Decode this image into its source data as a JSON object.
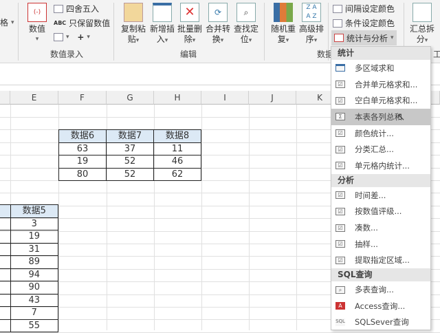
{
  "ribbon": {
    "cut_left_label": "格",
    "number_value": {
      "label": "数值"
    },
    "round": "四舍五入",
    "keep_value": "只保留数值",
    "plus": "+",
    "group_number_input": "数值录入",
    "copy_paste": {
      "l1": "复制粘",
      "l2": "贴"
    },
    "insert_new": {
      "l1": "新增插",
      "l2": "入"
    },
    "batch_delete": {
      "l1": "批量删",
      "l2": "除"
    },
    "merge_convert": {
      "l1": "合并转",
      "l2": "换"
    },
    "find_locate": {
      "l1": "查找定",
      "l2": "位"
    },
    "group_edit": "编辑",
    "random_repeat": {
      "l1": "随机重",
      "l2": "复"
    },
    "advanced_sort": {
      "l1": "高级排",
      "l2": "序"
    },
    "interval_color": "间隔设定颜色",
    "cond_color": "条件设定颜色",
    "stats_analysis": "统计与分析",
    "group_data": "数据",
    "summary_split": {
      "l1": "汇总拆",
      "l2": "分"
    },
    "group_tools": "工"
  },
  "columns": [
    "E",
    "F",
    "G",
    "H",
    "I",
    "J",
    "K"
  ],
  "table1": {
    "headers": [
      "数据6",
      "数据7",
      "数据8"
    ],
    "rows": [
      [
        "63",
        "37",
        "11"
      ],
      [
        "19",
        "52",
        "46"
      ],
      [
        "80",
        "52",
        "62"
      ]
    ]
  },
  "table2": {
    "header": "数据5",
    "values": [
      "3",
      "19",
      "31",
      "89",
      "94",
      "90",
      "43",
      "7",
      "55"
    ]
  },
  "menu": {
    "sections": [
      {
        "title": "统计",
        "items": [
          "多区域求和",
          "合并单元格求和...",
          "空白单元格求和...",
          "本表各列总和",
          "颜色统计...",
          "分类汇总...",
          "单元格内统计..."
        ]
      },
      {
        "title": "分析",
        "items": [
          "时间差...",
          "按数值评级...",
          "凑数...",
          "抽样...",
          "提取指定区域..."
        ]
      },
      {
        "title": "SQL查询",
        "items": [
          "多表查询...",
          "Access查询...",
          "SQLSever查询"
        ]
      }
    ],
    "highlighted": "本表各列总和"
  }
}
